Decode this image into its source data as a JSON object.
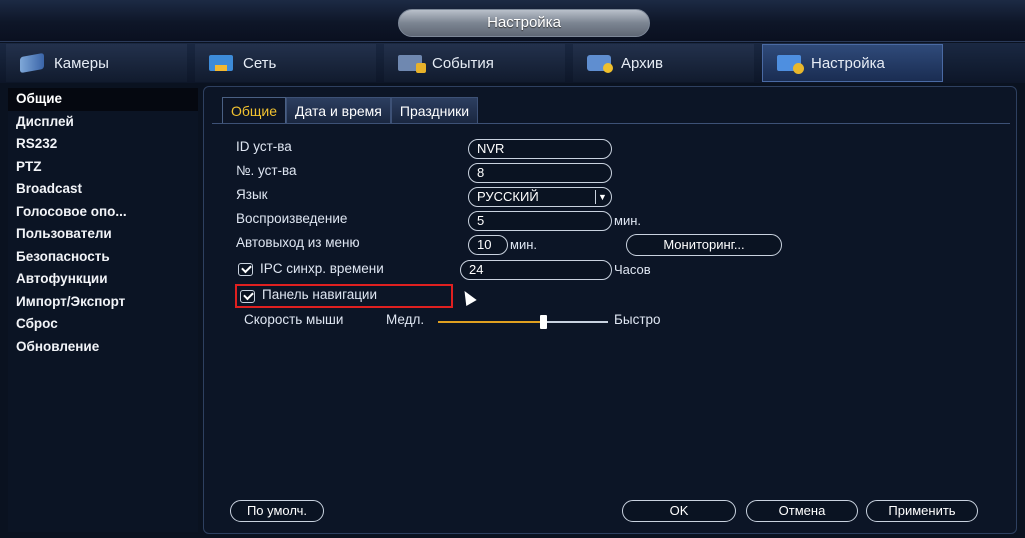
{
  "window": {
    "title": "Настройка"
  },
  "topnav": {
    "tabs": [
      {
        "label": "Камеры",
        "icon": "camera-icon"
      },
      {
        "label": "Сеть",
        "icon": "network-icon"
      },
      {
        "label": "События",
        "icon": "events-icon"
      },
      {
        "label": "Архив",
        "icon": "archive-icon"
      },
      {
        "label": "Настройка",
        "icon": "settings-icon",
        "active": true
      }
    ]
  },
  "sidebar": {
    "items": [
      {
        "label": "Общие",
        "active": true
      },
      {
        "label": "Дисплей"
      },
      {
        "label": "RS232"
      },
      {
        "label": "PTZ"
      },
      {
        "label": "Broadcast"
      },
      {
        "label": "Голосовое опо..."
      },
      {
        "label": "Пользователи"
      },
      {
        "label": "Безопасность"
      },
      {
        "label": "Автофункции"
      },
      {
        "label": "Импорт/Экспорт"
      },
      {
        "label": "Сброс"
      },
      {
        "label": "Обновление"
      }
    ]
  },
  "subtabs": [
    {
      "label": "Общие",
      "active": true
    },
    {
      "label": "Дата и время"
    },
    {
      "label": "Праздники"
    }
  ],
  "form": {
    "device_id": {
      "label": "ID уст-ва",
      "value": "NVR"
    },
    "device_no": {
      "label": "№. уст-ва",
      "value": "8"
    },
    "language": {
      "label": "Язык",
      "value": "РУССКИЙ"
    },
    "playback": {
      "label": "Воспроизведение",
      "value": "5",
      "unit": "мин."
    },
    "auto_logout": {
      "label": "Автовыход из меню",
      "value": "10",
      "unit": "мин.",
      "monitor_button": "Мониторинг..."
    },
    "ipc_sync": {
      "label": "IPC синхр. времени",
      "value": "24",
      "unit": "Часов",
      "checked": true
    },
    "nav_panel": {
      "label": "Панель навигации",
      "checked": true
    },
    "mouse_speed": {
      "label": "Скорость мыши",
      "min_label": "Медл.",
      "max_label": "Быстро",
      "level": 0.62
    }
  },
  "buttons": {
    "default": "По умолч.",
    "ok": "OK",
    "cancel": "Отмена",
    "apply": "Применить"
  },
  "colors": {
    "active_subtab": "#f2c230",
    "highlight": "#e02020",
    "slider_fill": "#e0a020"
  }
}
